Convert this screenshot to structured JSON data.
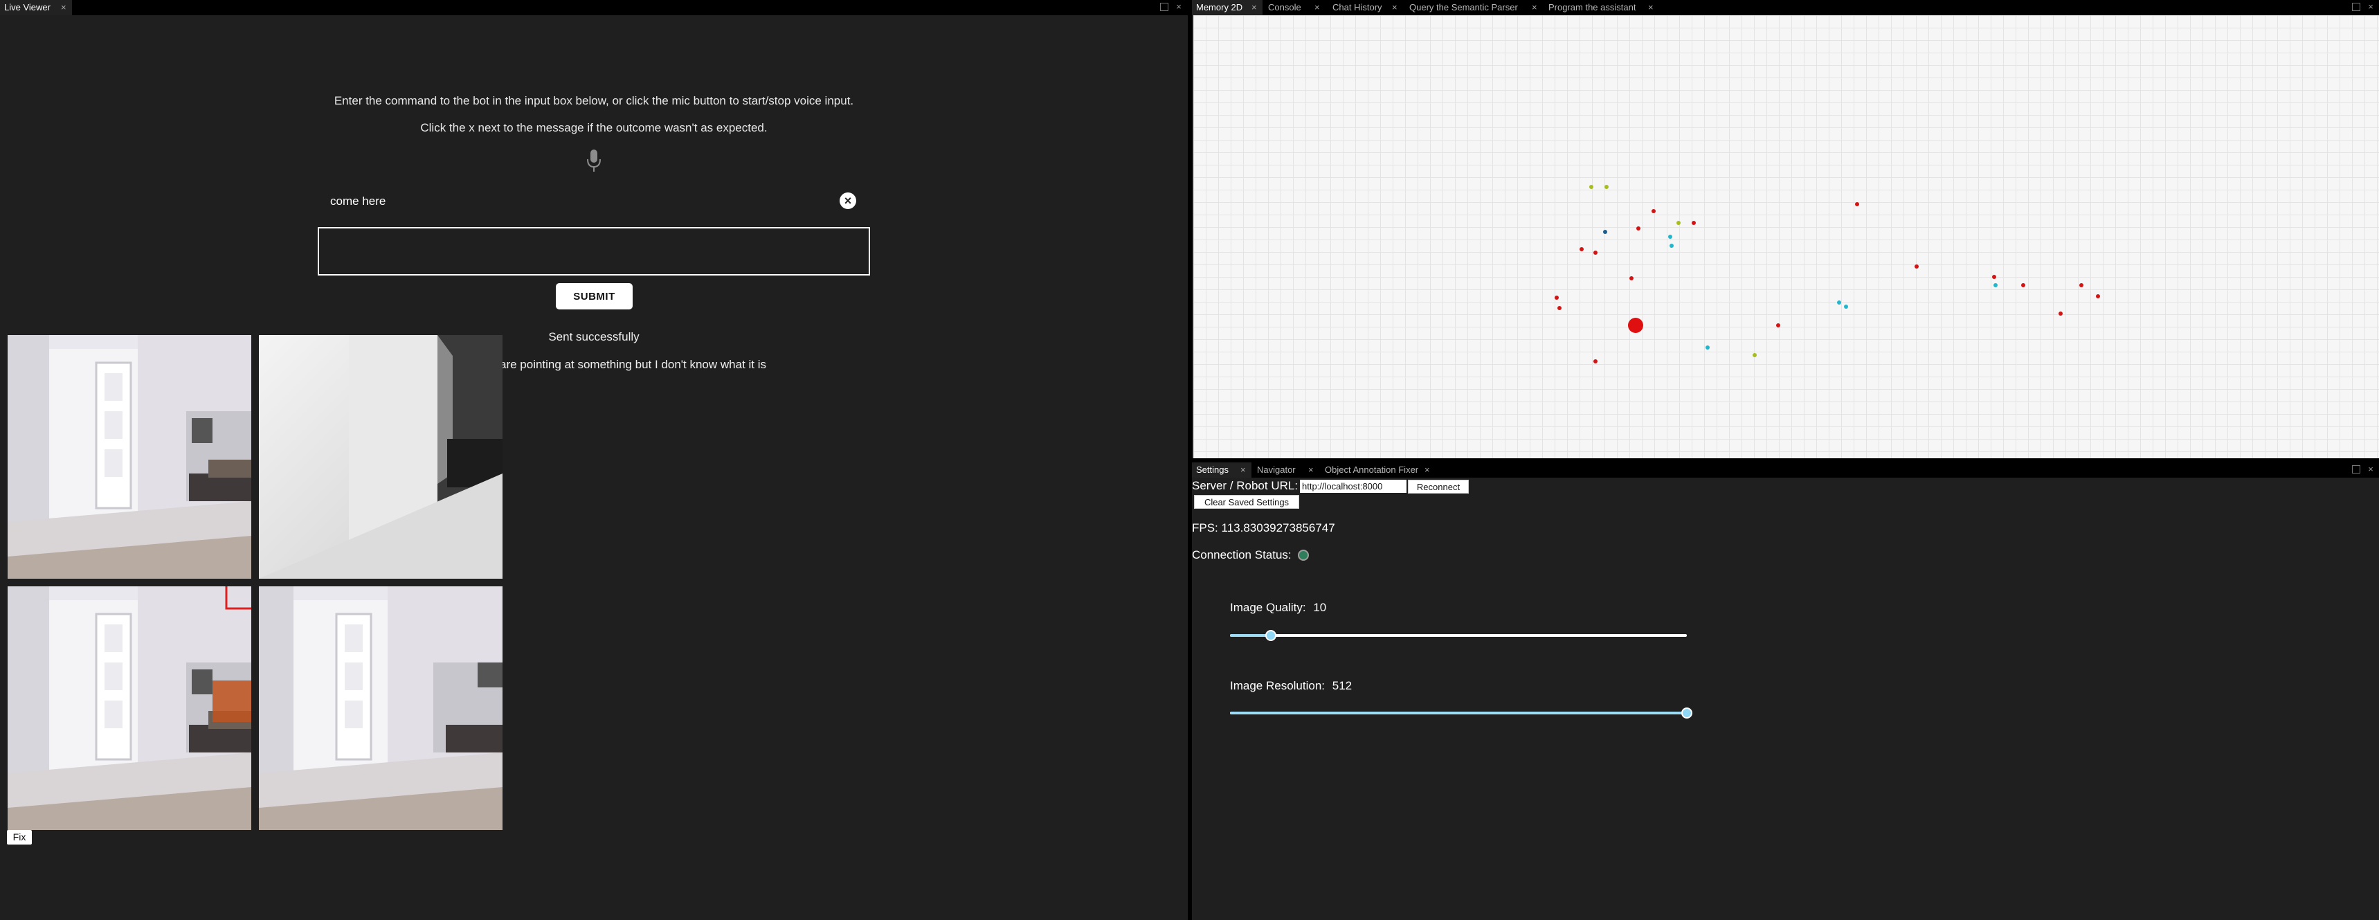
{
  "left_panel": {
    "tab_label": "Live Viewer",
    "instruction_1": "Enter the command to the bot in the input box below, or click the mic button to start/stop voice input.",
    "instruction_2": "Click the x next to the message if the outcome wasn't as expected.",
    "last_command": "come here",
    "command_input_value": "",
    "submit_label": "SUBMIT",
    "status_message": "Sent successfully",
    "bot_reply": "are pointing at something but I don't know what it is",
    "fix_label": "Fix"
  },
  "top_right": {
    "tabs": [
      {
        "label": "Memory 2D"
      },
      {
        "label": "Console"
      },
      {
        "label": "Chat History"
      },
      {
        "label": "Query the Semantic Parser"
      },
      {
        "label": "Program the assistant"
      }
    ]
  },
  "memory_map": {
    "colors": {
      "red": "#d31414",
      "cyan": "#22b6cc",
      "olive": "#a6bd1d",
      "navy": "#1f5d8c",
      "robot": "#e01010"
    },
    "points": [
      {
        "color": "olive"
      },
      {
        "color": "olive"
      },
      {
        "color": "red"
      },
      {
        "color": "red"
      },
      {
        "color": "olive"
      },
      {
        "color": "red"
      },
      {
        "color": "navy"
      },
      {
        "color": "cyan"
      },
      {
        "color": "red"
      },
      {
        "color": "red"
      },
      {
        "color": "red"
      },
      {
        "color": "cyan"
      },
      {
        "color": "red"
      },
      {
        "color": "red"
      },
      {
        "color": "red"
      },
      {
        "color": "cyan"
      },
      {
        "color": "cyan"
      },
      {
        "color": "red"
      },
      {
        "color": "red"
      },
      {
        "color": "red"
      },
      {
        "color": "red"
      },
      {
        "color": "red"
      },
      {
        "color": "red"
      },
      {
        "color": "cyan"
      },
      {
        "color": "red"
      },
      {
        "color": "cyan"
      },
      {
        "color": "olive"
      },
      {
        "color": "red"
      }
    ]
  },
  "bottom_right": {
    "tabs": [
      {
        "label": "Settings"
      },
      {
        "label": "Navigator"
      },
      {
        "label": "Object Annotation Fixer"
      }
    ],
    "server_label": "Server / Robot URL:",
    "server_url": "http://localhost:8000",
    "reconnect_label": "Reconnect",
    "clear_label": "Clear Saved Settings",
    "fps_text": "FPS: 113.83039273856747",
    "connection_label": "Connection Status:",
    "image_quality_label": "Image Quality:",
    "image_quality_value": "10",
    "image_quality_fraction": 0.09,
    "image_resolution_label": "Image Resolution:",
    "image_resolution_value": "512",
    "image_resolution_fraction": 1.0
  }
}
